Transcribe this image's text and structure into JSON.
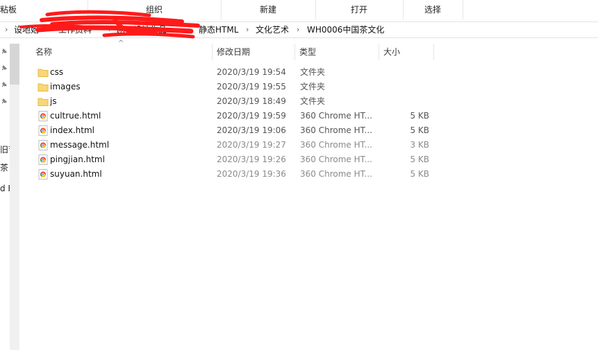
{
  "ribbon": {
    "groups": [
      "粘板",
      "组织",
      "新建",
      "打开",
      "选择"
    ]
  },
  "address": {
    "crumbs": [
      "设地始",
      "工作资料",
      "网页设计作品",
      "静态HTML",
      "文化艺术",
      "WH0006中国茶文化"
    ]
  },
  "nav": {
    "texts": [
      "旧节",
      "茶",
      "d F"
    ]
  },
  "columns": {
    "name": "名称",
    "date": "修改日期",
    "type": "类型",
    "size": "大小"
  },
  "files": [
    {
      "name": "css",
      "date": "2020/3/19 19:54",
      "type": "文件夹",
      "size": "",
      "icon": "folder-icon"
    },
    {
      "name": "images",
      "date": "2020/3/19 19:55",
      "type": "文件夹",
      "size": "",
      "icon": "folder-icon"
    },
    {
      "name": "js",
      "date": "2020/3/19 18:49",
      "type": "文件夹",
      "size": "",
      "icon": "folder-icon"
    },
    {
      "name": "cultrue.html",
      "date": "2020/3/19 19:59",
      "type": "360 Chrome HT...",
      "size": "5 KB",
      "icon": "html-file-icon"
    },
    {
      "name": "index.html",
      "date": "2020/3/19 19:06",
      "type": "360 Chrome HT...",
      "size": "5 KB",
      "icon": "html-file-icon"
    },
    {
      "name": "message.html",
      "date": "2020/3/19 19:27",
      "type": "360 Chrome HT...",
      "size": "3 KB",
      "icon": "html-file-icon"
    },
    {
      "name": "pingjian.html",
      "date": "2020/3/19 19:26",
      "type": "360 Chrome HT...",
      "size": "5 KB",
      "icon": "html-file-icon"
    },
    {
      "name": "suyuan.html",
      "date": "2020/3/19 19:36",
      "type": "360 Chrome HT...",
      "size": "5 KB",
      "icon": "html-file-icon"
    }
  ],
  "colors": {
    "folder": "#f8d775",
    "folder_dark": "#e6b84a",
    "redaction": "#ff1a1a",
    "scroll_track": "#f0f0f0"
  }
}
